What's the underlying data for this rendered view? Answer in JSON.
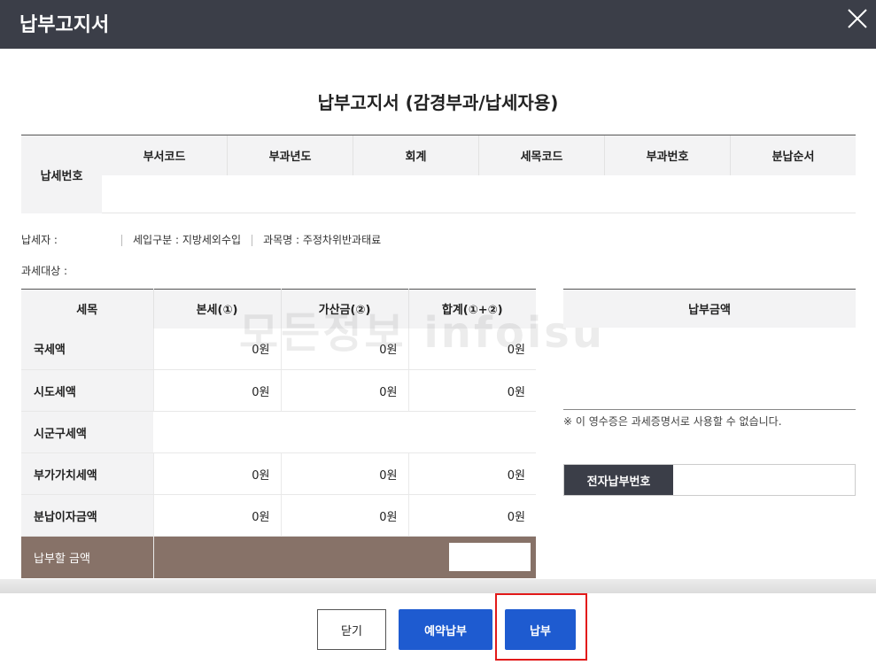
{
  "header": {
    "title": "납부고지서"
  },
  "document": {
    "title": "납부고지서 (감경부과/납세자용)"
  },
  "top_table": {
    "left_label": "납세번호",
    "columns": [
      "부서코드",
      "부과년도",
      "회계",
      "세목코드",
      "부과번호",
      "분납순서"
    ]
  },
  "info": {
    "taxpayer": "납세자 :",
    "income_type": "세입구분 : 지방세외수입",
    "subject": "과목명 : 주정차위반과태료",
    "target": "과세대상 :"
  },
  "tax_table": {
    "headers": [
      "세목",
      "본세(①)",
      "가산금(②)",
      "합계(①+②)"
    ],
    "rows": [
      {
        "label": "국세액",
        "values": [
          "0원",
          "0원",
          "0원"
        ]
      },
      {
        "label": "시도세액",
        "values": [
          "0원",
          "0원",
          "0원"
        ]
      },
      {
        "label": "시군구세액",
        "values": [
          "",
          "",
          ""
        ]
      },
      {
        "label": "부가가치세액",
        "values": [
          "0원",
          "0원",
          "0원"
        ]
      },
      {
        "label": "분납이자금액",
        "values": [
          "0원",
          "0원",
          "0원"
        ]
      }
    ],
    "total_label": "납부할 금액"
  },
  "payment_panel": {
    "heading": "납부금액",
    "note": "※ 이 영수증은 과세증명서로 사용할 수 없습니다.",
    "epay_label": "전자납부번호"
  },
  "watermark": "모든정보 infoisu",
  "buttons": {
    "close": "닫기",
    "reserve": "예약납부",
    "pay": "납부"
  },
  "colors": {
    "header": "#3b3e48",
    "primary": "#1e5bd0",
    "total_row": "#877268",
    "highlight": "#e21a1a"
  }
}
